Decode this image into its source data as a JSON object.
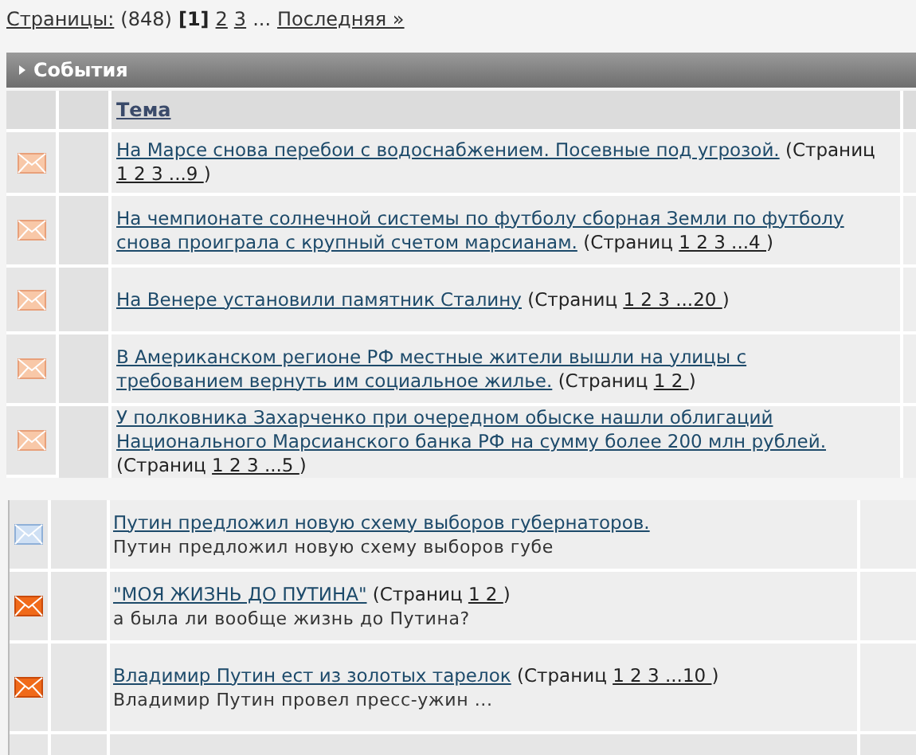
{
  "pager": {
    "label": "Страницы:",
    "count": "(848)",
    "pages": [
      {
        "text": "[1]",
        "selected": true
      },
      {
        "text": "2",
        "selected": false
      },
      {
        "text": "3",
        "selected": false
      }
    ],
    "ellipsis": "...",
    "last": "Последняя »"
  },
  "section": {
    "title": "События",
    "columns": [
      "Тема"
    ],
    "topics": [
      {
        "kind": "faded",
        "title": "На Марсе снова перебои с водоснабжением. Посевные под угрозой.",
        "pages_label": "(Страниц",
        "pages": "1 2 3 ...9 ",
        "pages_close": ")"
      },
      {
        "kind": "faded",
        "title": [
          "На чемпионате солнечной системы по футболу сборная Земли по футболу",
          "снова проиграла с крупный счетом марсианам."
        ],
        "pages_label": "(Страниц",
        "pages": "1 2 3 ...4 ",
        "pages_close": ")"
      },
      {
        "kind": "faded",
        "title": "На Венере установили памятник Сталину",
        "pages_label": "(Страниц",
        "pages": "1 2 3 ...20 ",
        "pages_close": ")"
      },
      {
        "kind": "faded",
        "title": [
          "В Американском регионе РФ местные жители вышли на улицы с",
          "требованием вернуть им социальное жилье."
        ],
        "pages_label": "(Страниц",
        "pages": "1 2 ",
        "pages_close": ")"
      },
      {
        "kind": "faded",
        "title": [
          "У полковника Захарченко при очередном обыске нашли облигаций",
          "Национального Марсианского банка РФ на сумму более 200 млн рублей."
        ],
        "pages_label": "(Страниц",
        "pages": "1 2 3 ...5 ",
        "pages_close": ")"
      }
    ]
  },
  "topics_2": [
    {
      "kind": "read",
      "title": "Путин предложил новую схему выборов губернаторов.",
      "description": "Путин предложил новую схему выборов губе"
    },
    {
      "kind": "new",
      "title": "\"МОЯ ЖИЗНЬ ДО ПУТИНА\"",
      "pages_label": "(Страниц",
      "pages": "1 2 ",
      "pages_close": ")",
      "description": "а была ли вообще жизнь до Путина?"
    },
    {
      "kind": "new",
      "title": "Владимир Путин ест из золотых тарелок",
      "pages_label": "(Страниц",
      "pages": "1 2 3 ...10 ",
      "pages_close": ")",
      "description": "Владимир Путин провел пресс-ужин ..."
    }
  ]
}
